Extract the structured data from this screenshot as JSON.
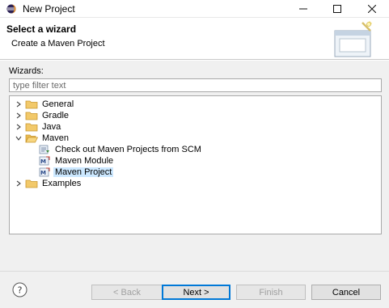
{
  "window": {
    "title": "New Project",
    "controls": [
      "minimize-icon",
      "maximize-icon",
      "close-icon"
    ]
  },
  "header": {
    "title": "Select a wizard",
    "subtitle": "Create a Maven Project"
  },
  "wizards": {
    "label": "Wizards:",
    "filter_placeholder": "type filter text"
  },
  "tree": [
    {
      "label": "General",
      "type": "folder",
      "expanded": false
    },
    {
      "label": "Gradle",
      "type": "folder",
      "expanded": false
    },
    {
      "label": "Java",
      "type": "folder",
      "expanded": false
    },
    {
      "label": "Maven",
      "type": "folder",
      "expanded": true
    },
    {
      "label": "Check out Maven Projects from SCM",
      "type": "leaf",
      "icon": "scm-checkout-icon"
    },
    {
      "label": "Maven Module",
      "type": "leaf",
      "icon": "maven-module-icon"
    },
    {
      "label": "Maven Project",
      "type": "leaf",
      "icon": "maven-project-icon",
      "selected": true
    },
    {
      "label": "Examples",
      "type": "folder",
      "expanded": false
    }
  ],
  "buttons": {
    "back": "< Back",
    "next": "Next >",
    "finish": "Finish",
    "cancel": "Cancel"
  },
  "colors": {
    "selection": "#cce8ff",
    "default_button_border": "#0078d7",
    "folder": "#e8b84a"
  }
}
